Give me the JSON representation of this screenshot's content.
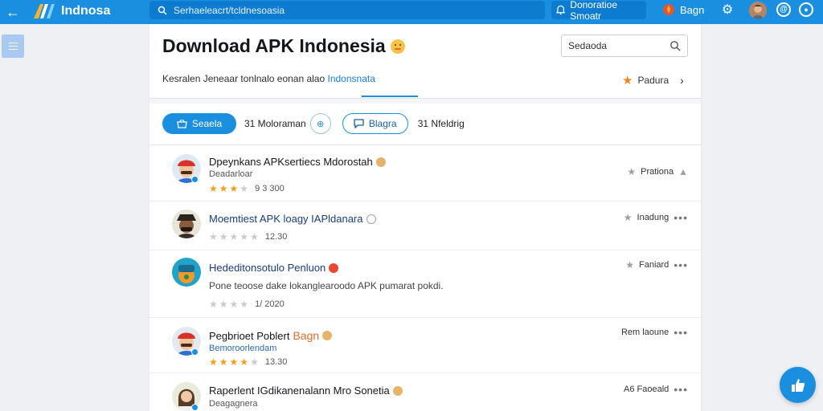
{
  "topbar": {
    "back_icon": "arrow-left-icon",
    "logo_text": "Indnosa",
    "search_placeholder": "Serhaeleacrt/tcldnesoasia",
    "notif_label": "Donoratioe Smoatr",
    "bagn_label": "Bagn",
    "accent": "#1a8fe0"
  },
  "panel": {
    "title": "Download APK Indonesia",
    "search_label": "Sedaoda",
    "subtitle_main": "Kesralen Jeneaar  tonlnalo eonan alao ",
    "subtitle_highlight": "Indonsnata",
    "popular_label": "Padura"
  },
  "filters": {
    "primary_label": "Seaela",
    "count1": "31 Moloraman",
    "outline_label": "Blagra",
    "count2": "31 Nfeldrig"
  },
  "rows": [
    {
      "title": "Dpeynkans APKsertiecs Mdorostah",
      "sub": "Deadarloar",
      "rating_on": 3,
      "rating_num": "9 3 300",
      "right_label": "Prationa"
    },
    {
      "title": "Moemtiest APK loagy IAPldanara",
      "rating_on": 0,
      "rating_num": "12.30",
      "right_label": "Inadung"
    },
    {
      "title": "Hededitonsotulo Penluon",
      "desc": "Pone teoose dake lokanglearoodo APK pumarat pokdi.",
      "rating_on": 0,
      "rating_num": "1/ 2020",
      "right_label": "Faniard"
    },
    {
      "title": "Pegbrioet Poblert",
      "title_extra": "Bagn",
      "sub": "Bemoroorlendam",
      "rating_on": 4,
      "rating_num": "13.30",
      "right_label": "Rem laoune"
    },
    {
      "title": "Raperlent IGdikanenalann Mro Sonetia",
      "sub": "Deagagnera",
      "right_label": "A6 Faoeald"
    }
  ],
  "fab_icon": "thumbs-up-icon"
}
